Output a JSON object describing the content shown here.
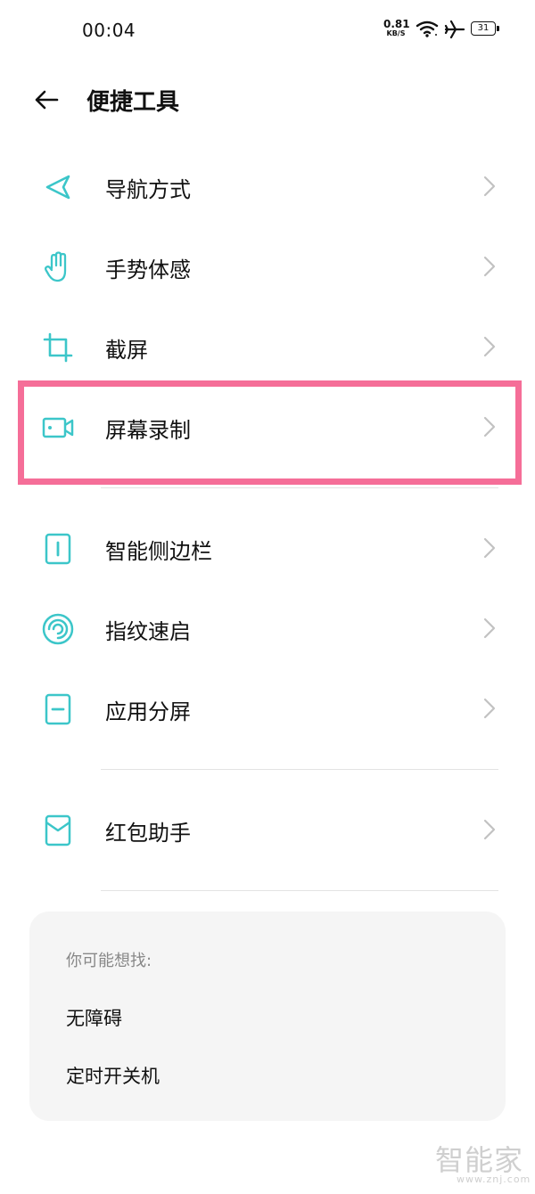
{
  "status_bar": {
    "time": "00:04",
    "net_speed_value": "0.81",
    "net_speed_unit": "KB/S",
    "battery": "31",
    "icons": [
      "wifi-icon",
      "airplane-mode-icon",
      "battery-icon"
    ]
  },
  "header": {
    "title": "便捷工具",
    "back_icon": "back-arrow-icon"
  },
  "colors": {
    "accent": "#3cc6c9",
    "highlight": "#f56e98",
    "chevron": "#c2c2c2",
    "card_bg": "#f5f5f5"
  },
  "menu": {
    "items": [
      {
        "label": "导航方式",
        "icon": "navigation-icon"
      },
      {
        "label": "手势体感",
        "icon": "hand-gesture-icon"
      },
      {
        "label": "截屏",
        "icon": "crop-icon"
      },
      {
        "label": "屏幕录制",
        "icon": "screen-record-icon",
        "highlighted": true
      },
      {
        "label": "智能侧边栏",
        "icon": "smart-sidebar-icon"
      },
      {
        "label": "指纹速启",
        "icon": "fingerprint-icon"
      },
      {
        "label": "应用分屏",
        "icon": "split-screen-icon"
      },
      {
        "label": "红包助手",
        "icon": "red-envelope-icon"
      }
    ]
  },
  "suggestions": {
    "title": "你可能想找:",
    "items": [
      "无障碍",
      "定时开关机"
    ]
  },
  "watermark": {
    "text": "智能家",
    "url": "www.znj.com"
  }
}
